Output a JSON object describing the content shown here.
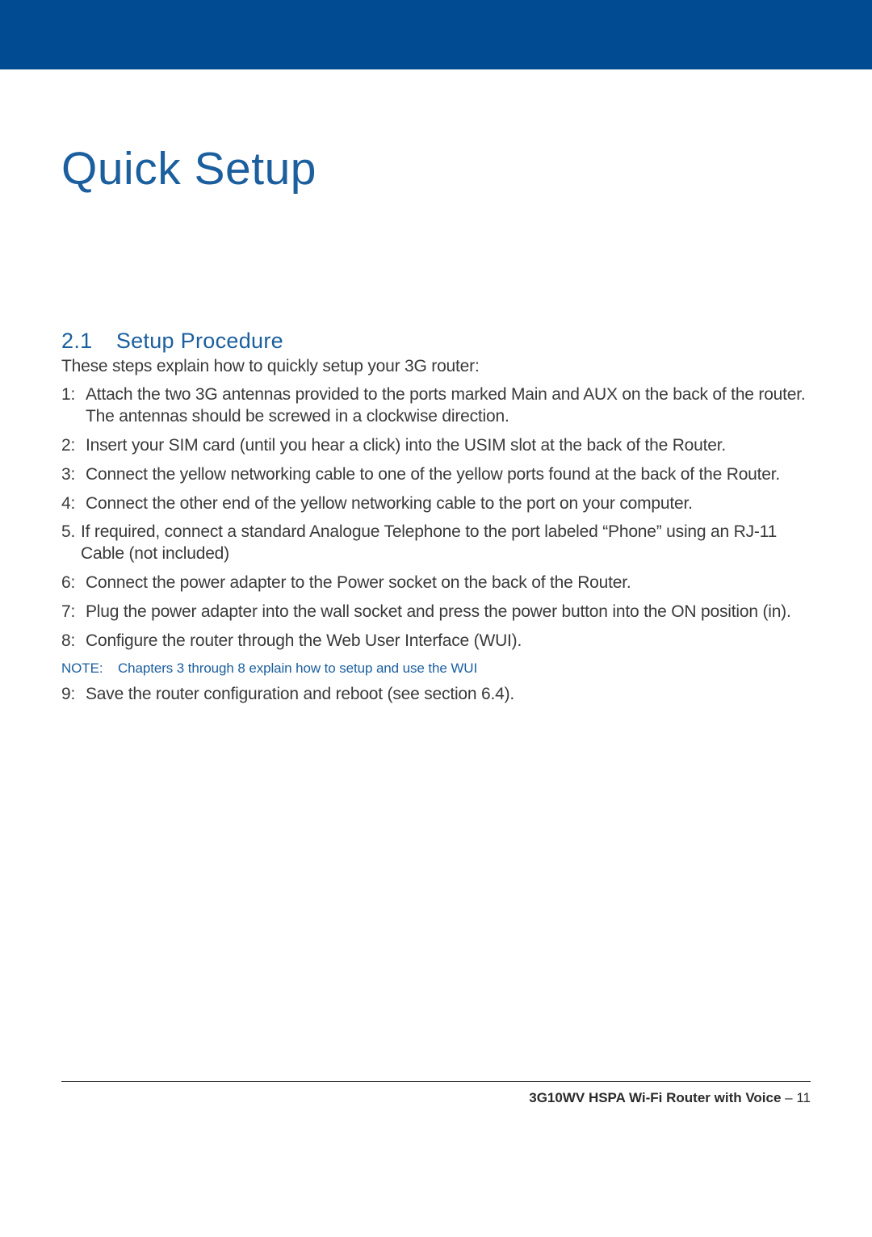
{
  "title": "Quick Setup",
  "section": {
    "number": "2.1",
    "name": "Setup Procedure"
  },
  "intro": "These steps explain how to quickly setup your 3G router:",
  "steps": [
    {
      "marker": "1:",
      "text": "Attach the two 3G antennas provided to the ports marked Main and AUX on the back of the router. The antennas should be screwed in a clockwise direction."
    },
    {
      "marker": "2:",
      "text": "Insert your SIM card (until you hear a click) into the USIM slot at the back of the Router."
    },
    {
      "marker": "3:",
      "text": "Connect the yellow networking cable to one of the yellow ports found at the back of the Router."
    },
    {
      "marker": "4:",
      "text": "Connect the other end of the yellow networking cable to the port on your computer."
    },
    {
      "marker": "5.",
      "text": "If required, connect a standard Analogue Telephone to the port labeled “Phone” using an RJ-11 Cable (not included)"
    },
    {
      "marker": "6:",
      "text": "Connect the power adapter to the Power socket on the back of the Router."
    },
    {
      "marker": "7:",
      "text": "Plug the power adapter into the wall socket and press the power button into the ON position (in)."
    },
    {
      "marker": "8:",
      "text": "Configure the router through the Web User Interface (WUI)."
    }
  ],
  "note": {
    "label": "NOTE:",
    "text": "Chapters 3 through 8 explain how to setup and use the WUI"
  },
  "post_note_step": {
    "marker": "9:",
    "text": "Save the router configuration and reboot (see section 6.4)."
  },
  "footer": {
    "product": "3G10WV HSPA Wi-Fi Router with Voice",
    "sep": " – ",
    "page": "11"
  }
}
